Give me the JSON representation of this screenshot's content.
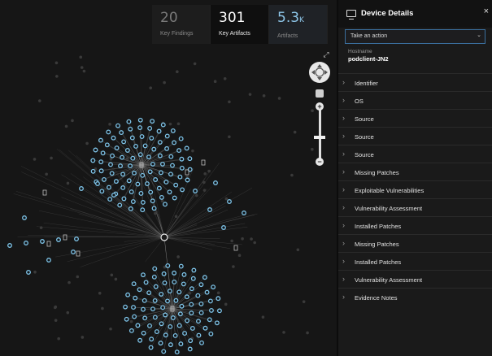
{
  "stats": [
    {
      "value": "20",
      "label": "Key Findings"
    },
    {
      "value": "301",
      "label": "Key Artifacts"
    },
    {
      "value": "5.3",
      "unit": "K",
      "label": "Artifacts"
    }
  ],
  "graph_controls": {
    "expand_icon": "expand-icon",
    "pan_icon": "pan-icon",
    "reset_icon": "fit-icon",
    "zoom_in": "+",
    "zoom_out": "−"
  },
  "panel": {
    "title": "Device Details",
    "close": "×",
    "action_placeholder": "Take an action",
    "hostname_label": "Hostname",
    "hostname_value": "podclient-JN2",
    "sections": [
      "Identifier",
      "OS",
      "Source",
      "Source",
      "Source",
      "Missing Patches",
      "Exploitable Vulnerabilities",
      "Vulnerability Assessment",
      "Installed Patches",
      "Missing Patches",
      "Installed Patches",
      "Vulnerability Assessment",
      "Evidence Notes"
    ]
  },
  "colors": {
    "node_ring": "#7fc4e8",
    "edge": "#9a9a9a",
    "accent": "#3b6f9e"
  }
}
